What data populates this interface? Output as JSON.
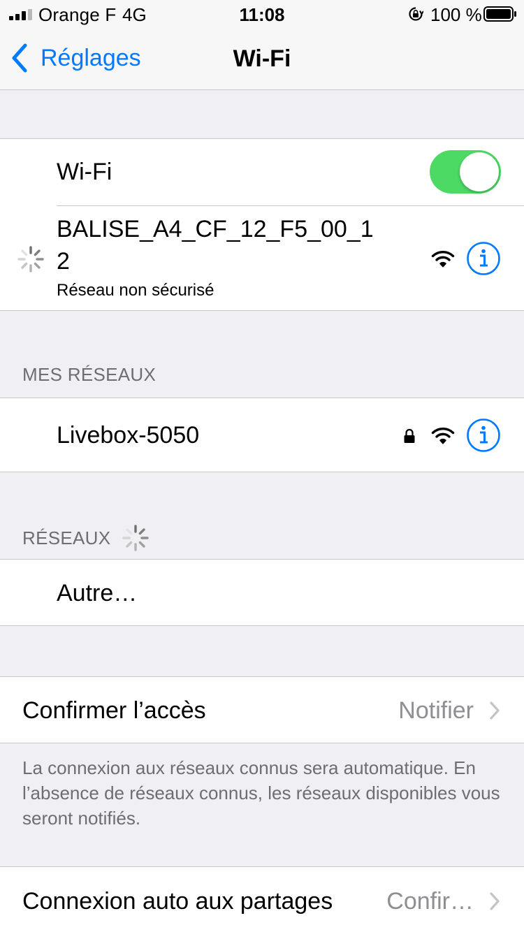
{
  "status_bar": {
    "carrier": "Orange F",
    "network": "4G",
    "time": "11:08",
    "battery_percent": "100 %",
    "battery_level": 1.0,
    "signal_bars_filled": 3,
    "signal_bars_total": 4,
    "icons": [
      "signal-icon",
      "rotation-lock-icon",
      "battery-icon"
    ]
  },
  "nav": {
    "back_label": "Réglages",
    "title": "Wi-Fi"
  },
  "wifi_section": {
    "toggle_label": "Wi-Fi",
    "toggle_on": true,
    "current_network": {
      "name_line1": "BALISE_A4_CF_12_F5_00_1",
      "name_line2": "2",
      "subtitle": "Réseau non sécurisé",
      "connecting": true,
      "secured": false
    }
  },
  "my_networks": {
    "header": "MES RÉSEAUX",
    "items": [
      {
        "name": "Livebox-5050",
        "secured": true
      }
    ]
  },
  "networks": {
    "header": "RÉSEAUX",
    "scanning": true,
    "items": [
      {
        "name": "Autre…"
      }
    ]
  },
  "ask_to_join": {
    "label": "Confirmer l’accès",
    "value": "Notifier",
    "footer": "La connexion aux réseaux connus sera automatique. En l’absence de réseaux connus, les réseaux disponibles vous seront notifiés."
  },
  "auto_join_hotspot": {
    "label": "Connexion auto aux partages",
    "value": "Confir…"
  },
  "colors": {
    "accent": "#007aff",
    "toggle_on": "#4cd964",
    "background": "#efeff4",
    "secondary_text": "#6d6d72",
    "value_text": "#8e8e93"
  }
}
